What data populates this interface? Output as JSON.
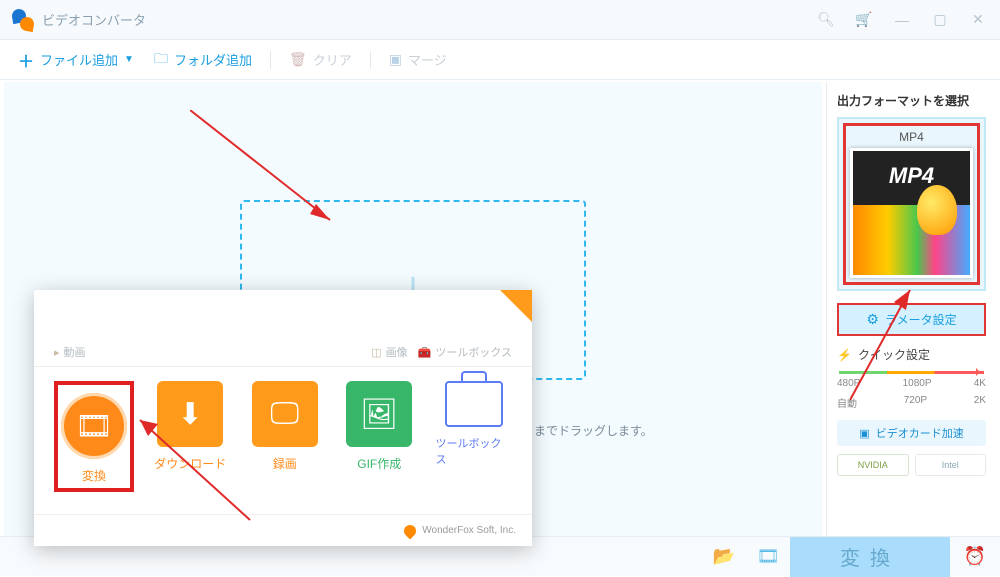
{
  "titlebar": {
    "title": "ビデオコンバータ"
  },
  "toolbar": {
    "add_file": "ファイル追加",
    "add_folder": "フォルダ追加",
    "clear": "クリア",
    "merge": "マージ"
  },
  "drop": {
    "hint_suffix": "こまでドラッグします。"
  },
  "sidebar": {
    "title": "出力フォーマットを選択",
    "format_label": "MP4",
    "format_thumb_text": "MP4",
    "param_button": "ラメータ設定",
    "quick_label": "クイック設定",
    "res_top": [
      "480P",
      "1080P",
      "4K"
    ],
    "res_bottom": [
      "自動",
      "720P",
      "2K"
    ],
    "gpu_button": "ビデオカード加速",
    "chips": [
      "NVIDIA",
      "Intel"
    ]
  },
  "bottombar": {
    "convert": "変換"
  },
  "popup": {
    "sections": {
      "video": "動画",
      "image": "画像",
      "toolbox": "ツールボックス"
    },
    "items": [
      {
        "label": "変換"
      },
      {
        "label": "ダウンロード"
      },
      {
        "label": "録画"
      },
      {
        "label": "GIF作成"
      },
      {
        "label": "ツールボックス"
      }
    ],
    "footer": "WonderFox Soft, Inc."
  }
}
